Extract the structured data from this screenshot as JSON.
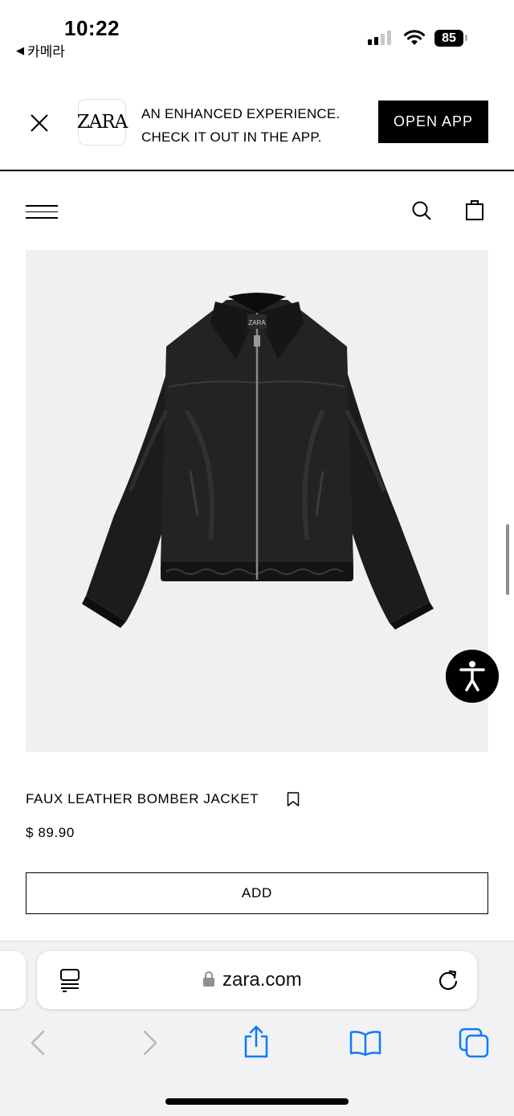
{
  "status_bar": {
    "time": "10:22",
    "back_app": "카메라",
    "battery": "85"
  },
  "app_banner": {
    "logo": "ZARA",
    "line1": "AN ENHANCED EXPERIENCE.",
    "line2": "CHECK IT OUT IN THE APP.",
    "button": "OPEN APP"
  },
  "header": {
    "icons": [
      "menu-icon",
      "search-icon",
      "shopping-bag-icon"
    ]
  },
  "product": {
    "name": "FAUX LEATHER BOMBER JACKET",
    "price": "$ 89.90",
    "add_label": "ADD",
    "image_bg": "#f0f0f0",
    "jacket_label": "ZARA"
  },
  "browser": {
    "url": "zara.com",
    "toolbar_icons": [
      "back-arrow-icon",
      "forward-arrow-icon",
      "share-icon",
      "bookmarks-icon",
      "tabs-icon"
    ]
  },
  "colors": {
    "accent": "#000000",
    "link_blue": "#0a7aff",
    "disabled": "#b8b8bd"
  }
}
